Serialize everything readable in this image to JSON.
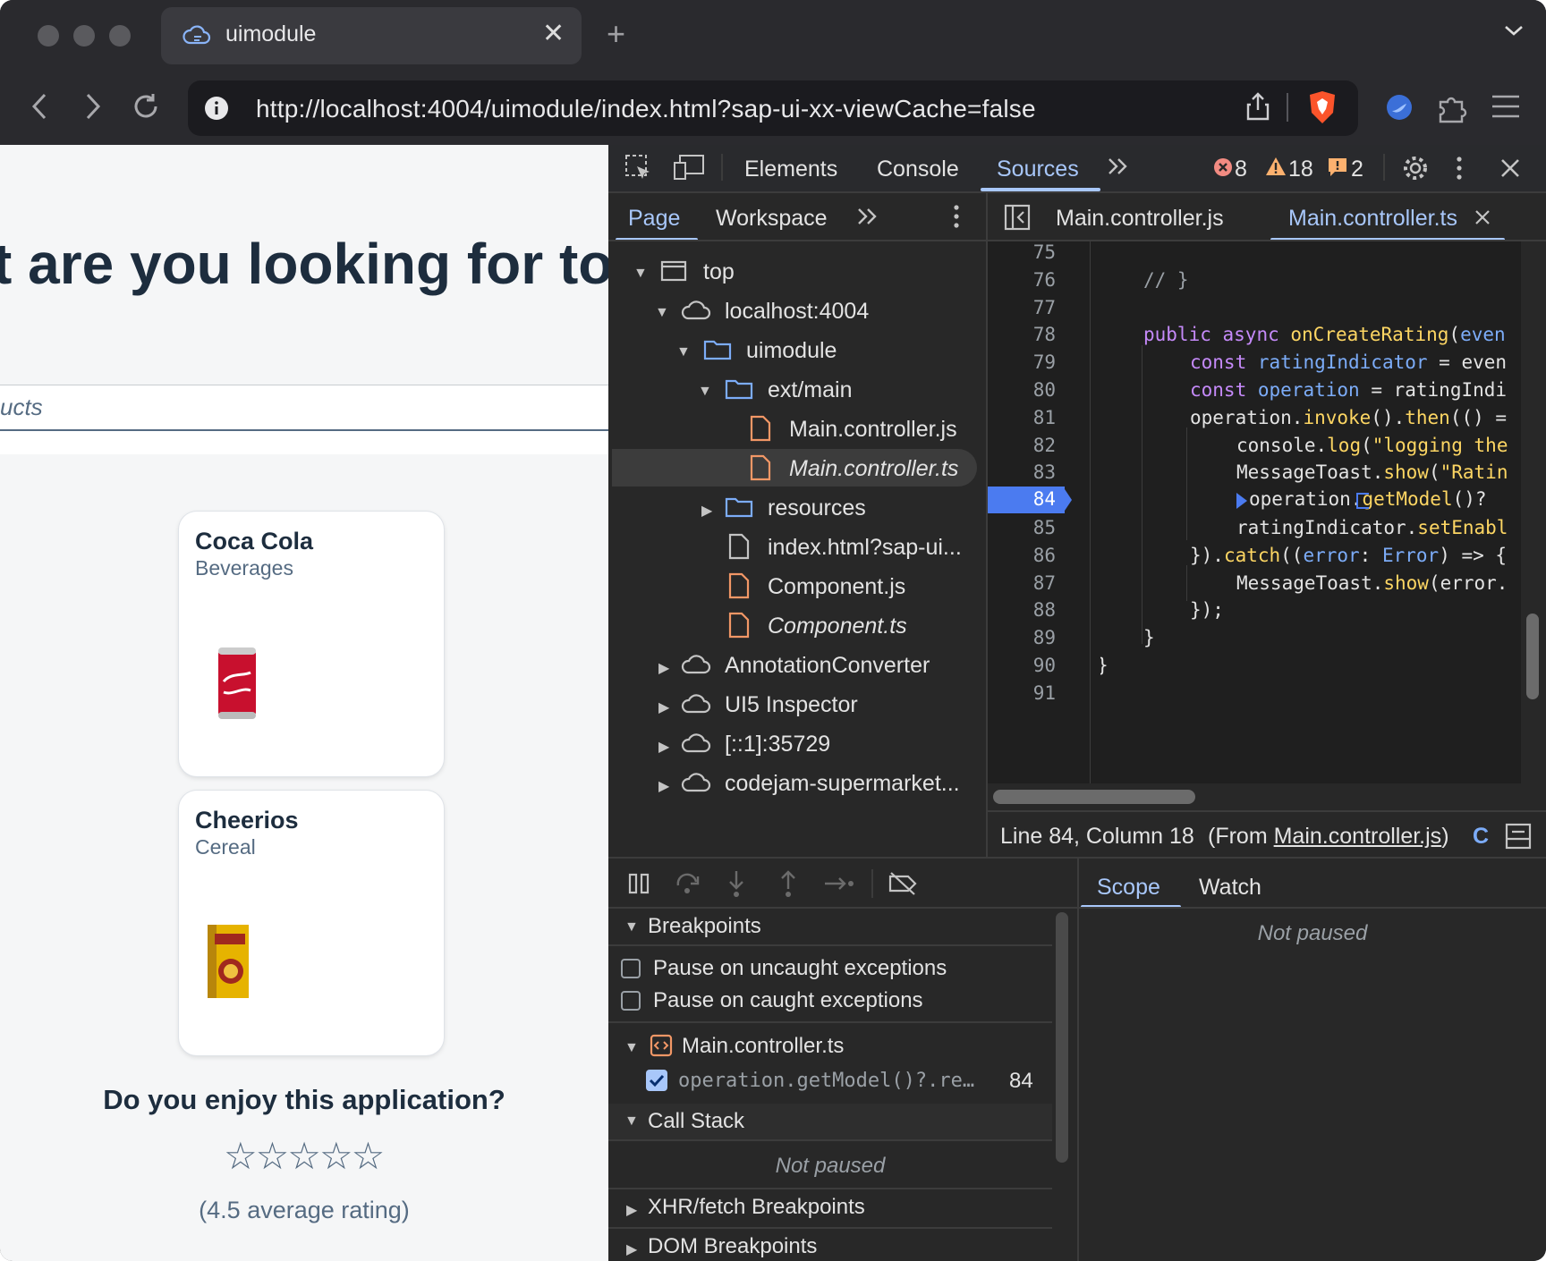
{
  "browser": {
    "tab_title": "uimodule",
    "tab_close": "✕",
    "new_tab": "+",
    "url": "http://localhost:4004/uimodule/index.html?sap-ui-xx-viewCache=false"
  },
  "page": {
    "heading": "t are you looking for to",
    "search_placeholder": "ucts",
    "products": [
      {
        "name": "Coca Cola",
        "category": "Beverages"
      },
      {
        "name": "Cheerios",
        "category": "Cereal"
      }
    ],
    "question": "Do you enjoy this application?",
    "stars": "☆☆☆☆☆",
    "rating_text": "(4.5 average rating)"
  },
  "devtools": {
    "tabs": [
      "Elements",
      "Console",
      "Sources"
    ],
    "active_tab": "Sources",
    "errors": "8",
    "warnings": "18",
    "issues": "2",
    "nav_tabs": [
      "Page",
      "Workspace"
    ],
    "editor_tabs": [
      "Main.controller.js",
      "Main.controller.ts"
    ],
    "tree": [
      {
        "label": "top"
      },
      {
        "label": "localhost:4004"
      },
      {
        "label": "uimodule"
      },
      {
        "label": "ext/main"
      },
      {
        "label": "Main.controller.js"
      },
      {
        "label": "Main.controller.ts"
      },
      {
        "label": "resources"
      },
      {
        "label": "index.html?sap-ui..."
      },
      {
        "label": "Component.js"
      },
      {
        "label": "Component.ts"
      },
      {
        "label": "AnnotationConverter"
      },
      {
        "label": "UI5 Inspector"
      },
      {
        "label": "[::1]:35729"
      },
      {
        "label": "codejam-supermarket..."
      }
    ],
    "line_numbers": [
      "75",
      "76",
      "77",
      "78",
      "79",
      "80",
      "81",
      "82",
      "83",
      "84",
      "85",
      "86",
      "87",
      "88",
      "89",
      "90",
      "91"
    ],
    "code": {
      "l76": "// }",
      "l78a": "public",
      "l78b": "async",
      "l78c": "onCreateRating",
      "l78d": "(",
      "l78e": "even",
      "l79a": "const",
      "l79b": "ratingIndicator",
      "l79c": " = even",
      "l80a": "const",
      "l80b": "operation",
      "l80c": " = ratingIndi",
      "l81a": "operation.",
      "l81b": "invoke",
      "l81c": "().",
      "l81d": "then",
      "l81e": "(() =",
      "l82a": "console.",
      "l82b": "log",
      "l82c": "(",
      "l82d": "\"logging the",
      "l83a": "MessageToast.",
      "l83b": "show",
      "l83c": "(",
      "l83d": "\"Ratin",
      "l84a": "operation.",
      "l84b": "getModel",
      "l84c": "()?",
      "l85a": "ratingIndicator.",
      "l85b": "setEnabl",
      "l86a": "}).",
      "l86b": "catch",
      "l86c": "((",
      "l86d": "error",
      "l86e": ": ",
      "l86f": "Error",
      "l86g": ") => {",
      "l87a": "MessageToast.",
      "l87b": "show",
      "l87c": "(error.",
      "l88": "});",
      "l89": "}",
      "l90": "}"
    },
    "status_line": "Line 84, Column 18",
    "status_from_prefix": "(From ",
    "status_from_link": "Main.controller.js",
    "status_from_suffix": ")",
    "status_c": "C",
    "debug_tabs": [
      "Scope",
      "Watch"
    ],
    "scope_state": "Not paused",
    "breakpoints_label": "Breakpoints",
    "pause_uncaught": "Pause on uncaught exceptions",
    "pause_caught": "Pause on caught exceptions",
    "bp_file": "Main.controller.ts",
    "bp_code": "operation.getModel()?.re…",
    "bp_line": "84",
    "call_stack_label": "Call Stack",
    "call_stack_state": "Not paused",
    "xhr_label": "XHR/fetch Breakpoints",
    "dom_label": "DOM Breakpoints"
  },
  "colors": {
    "accent": "#a8c7fa",
    "breakpoint": "#4b7bf0",
    "page_text": "#1d2d3e"
  }
}
